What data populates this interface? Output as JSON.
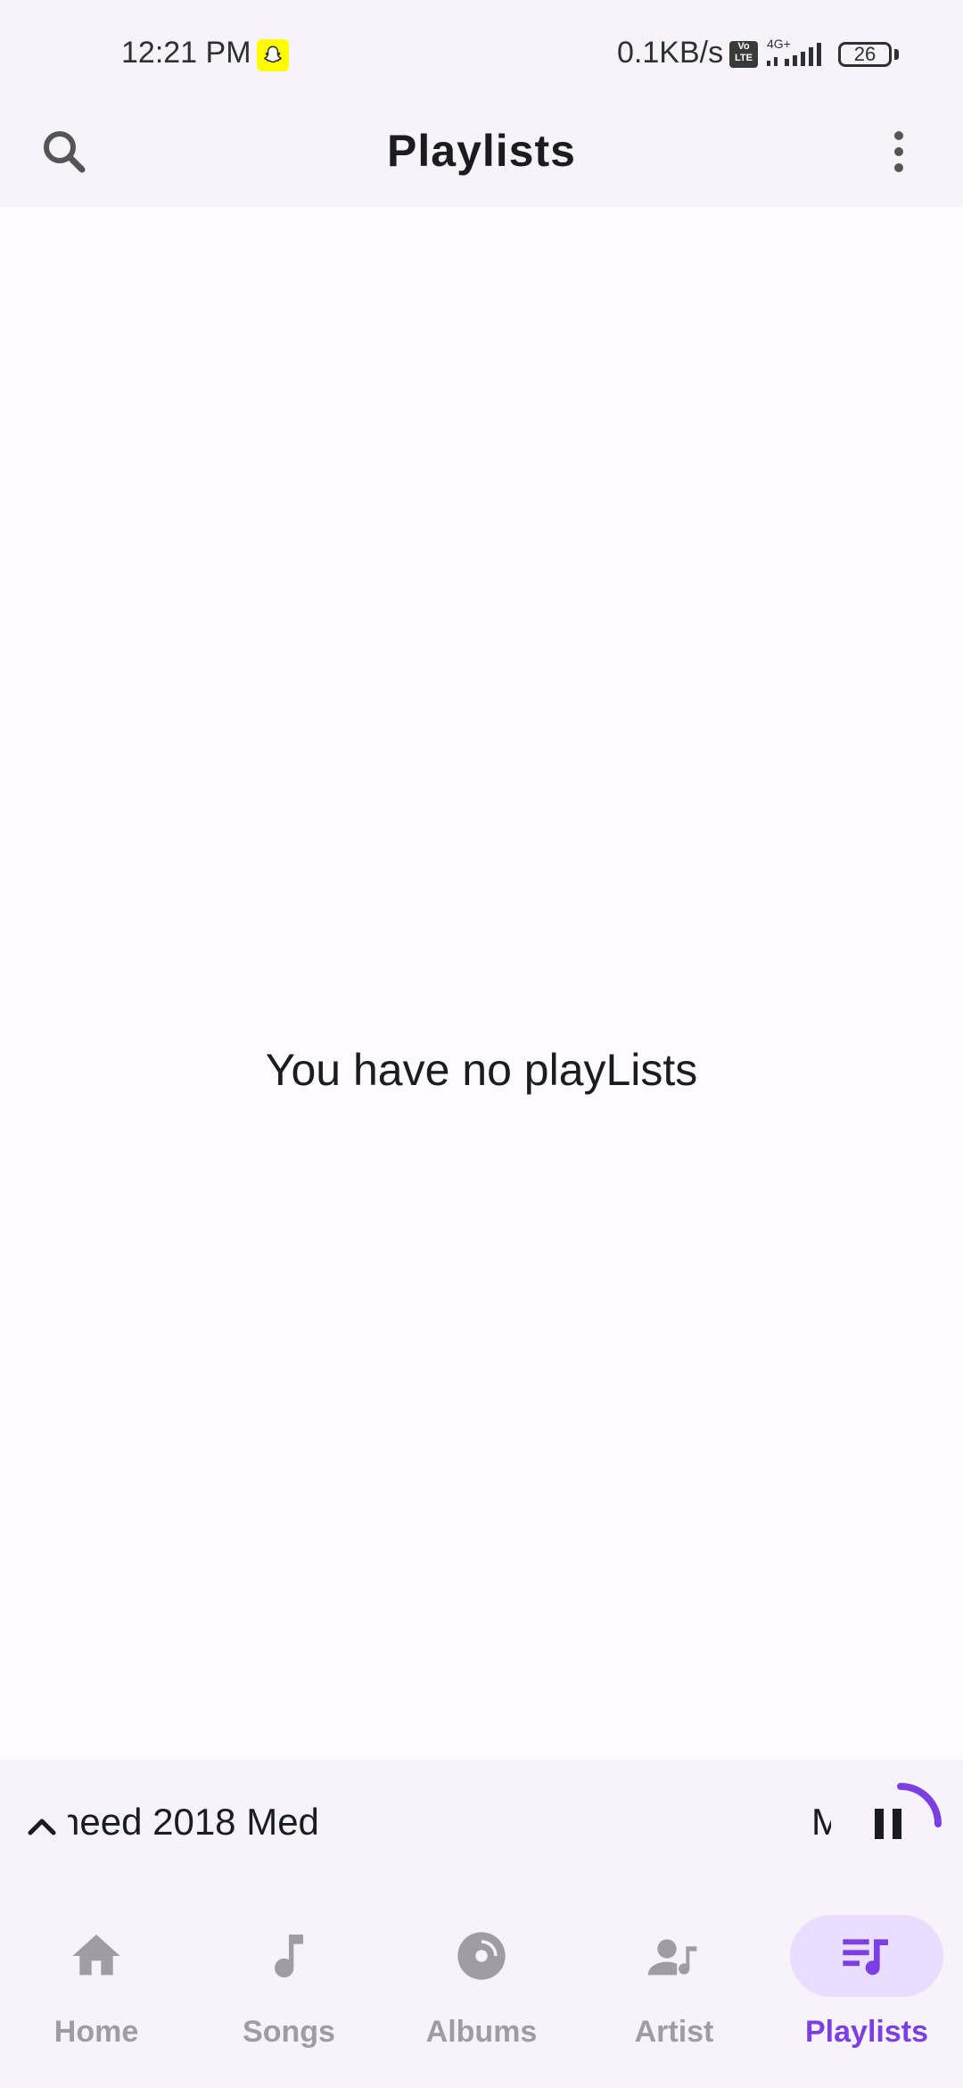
{
  "status_bar": {
    "time": "12:21 PM",
    "net_speed": "0.1KB/s",
    "volte": "Vo LTE",
    "network": "4G+",
    "battery": "26"
  },
  "app_bar": {
    "title": "Playlists",
    "search_icon": "search-icon",
    "more_icon": "more-vert-icon"
  },
  "content": {
    "empty_message": "You have no playLists"
  },
  "mini_player": {
    "track_title": "need 2018 Med",
    "track_artist": "M",
    "progress": 0.25,
    "state": "playing"
  },
  "bottom_nav": {
    "items": [
      {
        "label": "Home",
        "icon": "home-icon",
        "active": false
      },
      {
        "label": "Songs",
        "icon": "music-note-icon",
        "active": false
      },
      {
        "label": "Albums",
        "icon": "album-icon",
        "active": false
      },
      {
        "label": "Artist",
        "icon": "artist-icon",
        "active": false
      },
      {
        "label": "Playlists",
        "icon": "queue-music-icon",
        "active": true
      }
    ]
  },
  "colors": {
    "accent": "#7b3fe4",
    "active_pill": "#eaddff",
    "inactive": "#a09ca4",
    "bar_bg": "#f7f3fb",
    "page_bg": "#fefbfe"
  }
}
